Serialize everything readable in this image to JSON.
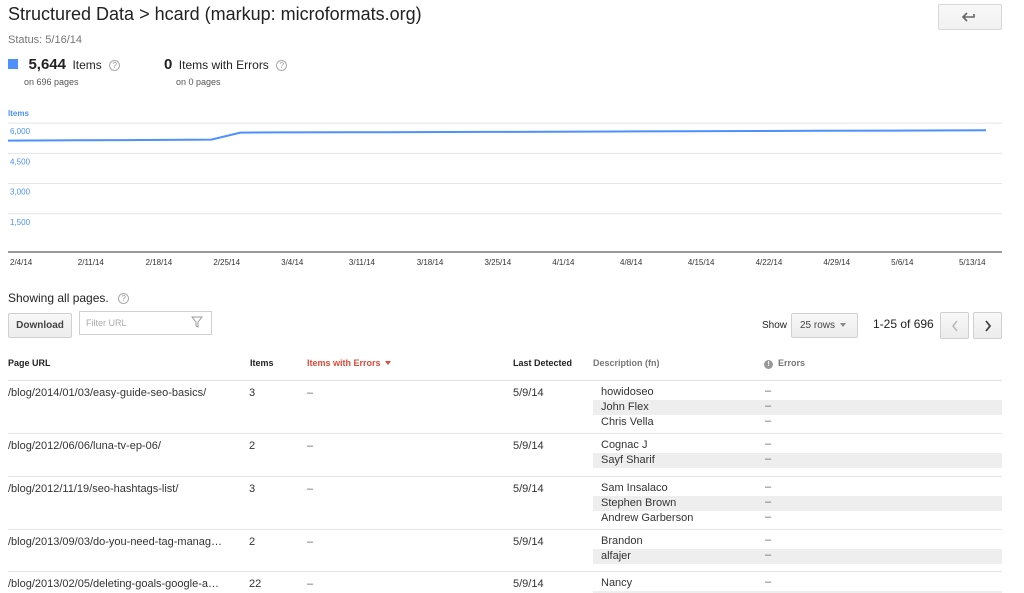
{
  "header": {
    "title": "Structured Data > hcard (markup: microformats.org)",
    "status": "Status: 5/16/14"
  },
  "metrics": {
    "items": {
      "value": "5,644",
      "label": "Items",
      "sub": "on 696 pages",
      "help": "?"
    },
    "errors": {
      "value": "0",
      "label": "Items with Errors",
      "sub": "on 0 pages",
      "help": "?"
    }
  },
  "colors": {
    "series": "#4d90fe",
    "error_header": "#dd4b39"
  },
  "chart_data": {
    "type": "line",
    "ylabel": "Items",
    "y_ticks": [
      "6,000",
      "4,500",
      "3,000",
      "1,500"
    ],
    "ylim": [
      0,
      6750
    ],
    "x_labels": [
      "2/4/14",
      "2/11/14",
      "2/18/14",
      "2/25/14",
      "3/4/14",
      "3/11/14",
      "3/18/14",
      "3/25/14",
      "4/1/14",
      "4/8/14",
      "4/15/14",
      "4/22/14",
      "4/29/14",
      "5/6/14",
      "5/13/14"
    ],
    "points": [
      {
        "x": "2/4/14",
        "y": 5130
      },
      {
        "x": "2/11/14",
        "y": 5145
      },
      {
        "x": "2/18/14",
        "y": 5160
      },
      {
        "x": "2/25/14",
        "y": 5180
      },
      {
        "x": "2/28/14",
        "y": 5530
      },
      {
        "x": "3/4/14",
        "y": 5540
      },
      {
        "x": "3/11/14",
        "y": 5545
      },
      {
        "x": "3/18/14",
        "y": 5555
      },
      {
        "x": "3/25/14",
        "y": 5565
      },
      {
        "x": "4/1/14",
        "y": 5575
      },
      {
        "x": "4/8/14",
        "y": 5585
      },
      {
        "x": "4/15/14",
        "y": 5600
      },
      {
        "x": "4/22/14",
        "y": 5610
      },
      {
        "x": "4/29/14",
        "y": 5620
      },
      {
        "x": "5/6/14",
        "y": 5630
      },
      {
        "x": "5/13/14",
        "y": 5640
      },
      {
        "x": "5/16/14",
        "y": 5644
      }
    ],
    "grid": true
  },
  "table_controls": {
    "showing": "Showing all pages.",
    "help": "?",
    "download_label": "Download",
    "filter_placeholder": "Filter URL",
    "show_label": "Show",
    "rows_select": "25 rows",
    "range": "1-25 of 696"
  },
  "table": {
    "columns": {
      "url": "Page URL",
      "items": "Items",
      "errors": "Items with Errors",
      "last": "Last Detected",
      "desc": "Description (fn)",
      "err": "Errors"
    },
    "rows": [
      {
        "url": "/blog/2014/01/03/easy-guide-seo-basics/",
        "items": "3",
        "errors": "–",
        "last": "5/9/14",
        "subs": [
          {
            "fn": "howidoseo",
            "err": "–"
          },
          {
            "fn": "John Flex",
            "err": "–"
          },
          {
            "fn": "Chris Vella",
            "err": "–"
          }
        ]
      },
      {
        "url": "/blog/2012/06/06/luna-tv-ep-06/",
        "items": "2",
        "errors": "–",
        "last": "5/9/14",
        "subs": [
          {
            "fn": "Cognac J",
            "err": "–"
          },
          {
            "fn": "Sayf Sharif",
            "err": "–"
          }
        ]
      },
      {
        "url": "/blog/2012/11/19/seo-hashtags-list/",
        "items": "3",
        "errors": "–",
        "last": "5/9/14",
        "subs": [
          {
            "fn": "Sam Insalaco",
            "err": "–"
          },
          {
            "fn": "Stephen Brown",
            "err": "–"
          },
          {
            "fn": "Andrew Garberson",
            "err": "–"
          }
        ]
      },
      {
        "url": "/blog/2013/09/03/do-you-need-tag-manag…",
        "items": "2",
        "errors": "–",
        "last": "5/9/14",
        "subs": [
          {
            "fn": "Brandon",
            "err": "–"
          },
          {
            "fn": "alfajer",
            "err": "–"
          }
        ]
      },
      {
        "url": "/blog/2013/02/05/deleting-goals-google-a…",
        "items": "22",
        "errors": "–",
        "last": "5/9/14",
        "subs": [
          {
            "fn": "Nancy",
            "err": "–"
          },
          {
            "fn": "",
            "err": ""
          }
        ]
      }
    ]
  }
}
